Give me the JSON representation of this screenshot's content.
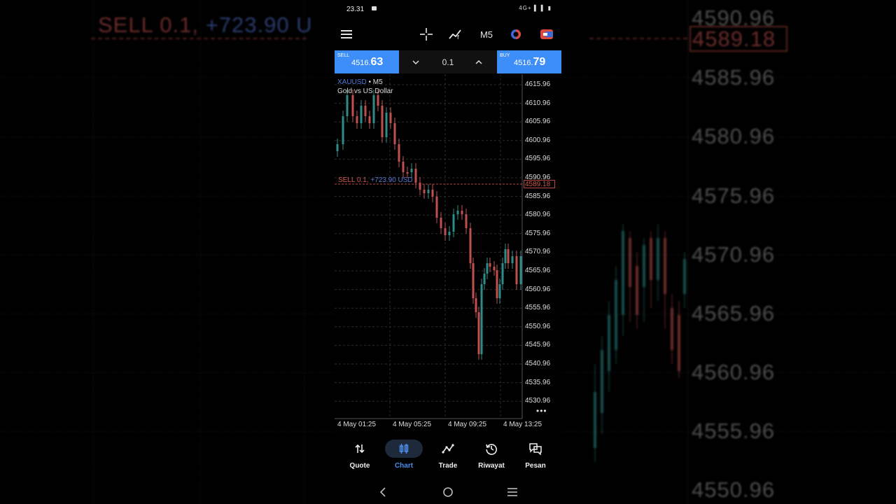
{
  "status_bar": {
    "time": "23.31",
    "icons": "4G+ ▌ ▌ ▮"
  },
  "toolbar": {
    "menu_icon": "hamburger-menu-icon",
    "crosshair_icon": "crosshair-icon",
    "indicators_icon": "indicators-icon",
    "timeframe": "M5",
    "objects_icon": "objects-icon",
    "trade_icon": "one-click-trade-icon"
  },
  "trade_panel": {
    "sell_label": "SELL",
    "sell_price_main": "4516.",
    "sell_price_big": "63",
    "buy_label": "BUY",
    "buy_price_main": "4516.",
    "buy_price_big": "79",
    "volume": "0.1"
  },
  "chart": {
    "symbol": "XAUUSD",
    "timeframe_suffix": " • M5",
    "description": "Gold vs US Dollar",
    "position_label_side": "SELL 0.1,",
    "position_label_profit": " +723.90 USD",
    "current_price": "4589.18",
    "price_levels": [
      "4615.96",
      "4610.96",
      "4605.96",
      "4600.96",
      "4595.96",
      "4590.96",
      "4585.96",
      "4580.96",
      "4575.96",
      "4570.96",
      "4565.96",
      "4560.96",
      "4555.96",
      "4550.96",
      "4545.96",
      "4540.96",
      "4535.96",
      "4530.96"
    ],
    "time_labels": [
      "4 May 01:25",
      "4 May 05:25",
      "4 May 09:25",
      "4 May 13:25"
    ],
    "more": "•••"
  },
  "bottom_nav": [
    {
      "label": "Quote",
      "icon": "quote-arrows-icon",
      "active": false
    },
    {
      "label": "Chart",
      "icon": "chart-candles-icon",
      "active": true
    },
    {
      "label": "Trade",
      "icon": "trade-line-icon",
      "active": false
    },
    {
      "label": "Riwayat",
      "icon": "history-icon",
      "active": false
    },
    {
      "label": "Pesan",
      "icon": "messages-icon",
      "active": false
    }
  ],
  "background": {
    "sell_text": "SELL 0.1,",
    "profit_text": "+723.90 U",
    "current_price": "4589.18",
    "price_levels": [
      "4590.96",
      "4585.96",
      "4580.96",
      "4575.96",
      "4570.96",
      "4565.96",
      "4560.96",
      "4555.96",
      "4550.96"
    ]
  },
  "colors": {
    "accent_blue": "#3d8ef8",
    "bull_candle": "#2e8b87",
    "bear_candle": "#c0504d",
    "profit_blue": "#5878d0"
  }
}
